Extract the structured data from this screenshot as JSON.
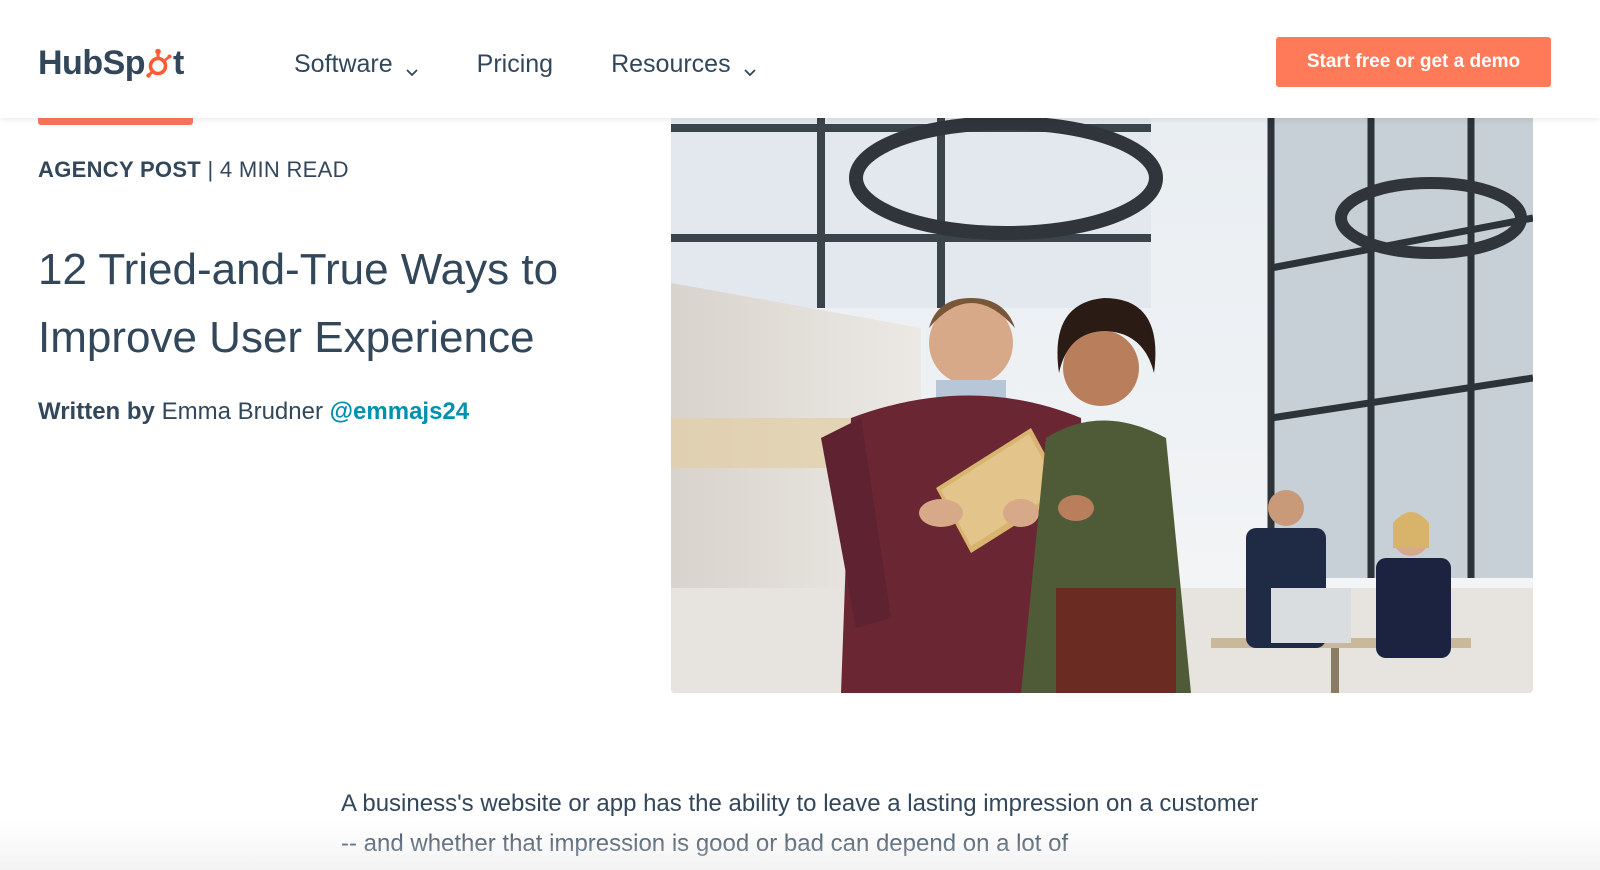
{
  "header": {
    "logo_text_left": "HubSp",
    "logo_text_right": "t",
    "nav": [
      {
        "label": "Software",
        "has_dropdown": true
      },
      {
        "label": "Pricing",
        "has_dropdown": false
      },
      {
        "label": "Resources",
        "has_dropdown": true
      }
    ],
    "cta_label": "Start free or get a demo"
  },
  "article": {
    "category": "AGENCY POST",
    "separator": "|",
    "read_time": "4 MIN READ",
    "title": "12 Tried-and-True Ways to Improve User Experience",
    "byline_label": "Written by",
    "author": "Emma Brudner",
    "author_handle": "@emmajs24",
    "intro": "A business's website or app has the ability to leave a lasting impression on a customer -- and whether that impression is good or bad can depend on a lot of"
  },
  "colors": {
    "brand_orange": "#ff7a59",
    "text": "#33475b",
    "link": "#0091ae"
  },
  "icons": {
    "logo_sprocket": "sprocket-icon",
    "dropdown": "chevron-down-icon"
  }
}
